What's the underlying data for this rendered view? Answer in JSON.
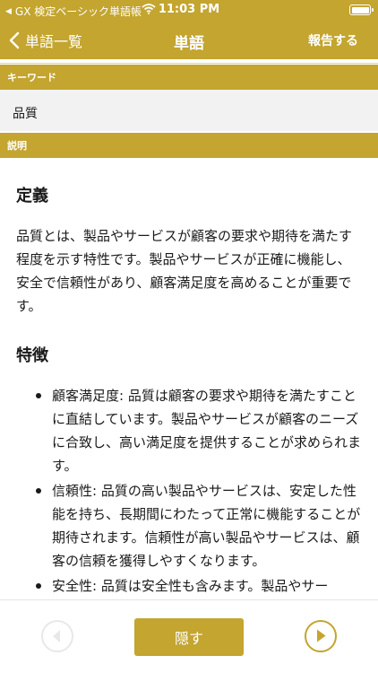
{
  "status_bar": {
    "carrier": "GX 検定ベーシック単語帳",
    "time": "11:03 PM"
  },
  "nav": {
    "back_label": "単語一覧",
    "title": "単語",
    "report_label": "報告する"
  },
  "keyword": {
    "header": "キーワード",
    "value": "品質"
  },
  "description": {
    "header": "説明",
    "definition_heading": "定義",
    "definition_text": "品質とは、製品やサービスが顧客の要求や期待を満たす程度を示す特性です。製品やサービスが正確に機能し、安全で信頼性があり、顧客満足度を高めることが重要です。",
    "features_heading": "特徴",
    "features": [
      "顧客満足度: 品質は顧客の要求や期待を満たすことに直結しています。製品やサービスが顧客のニーズに合致し、高い満足度を提供することが求められます。",
      "信頼性: 品質の高い製品やサービスは、安定した性能を持ち、長期間にわたって正常に機能することが期待されます。信頼性が高い製品やサービスは、顧客の信頼を獲得しやすくなります。",
      "安全性: 品質は安全性も含みます。製品やサー"
    ]
  },
  "bottom": {
    "hide_label": "隠す"
  },
  "colors": {
    "accent": "#c3a52f",
    "section_bg": "#f2f2f2"
  },
  "icons": [
    "back-chevron-icon",
    "wifi-icon",
    "battery-icon",
    "previous-arrow-icon",
    "next-play-icon"
  ]
}
